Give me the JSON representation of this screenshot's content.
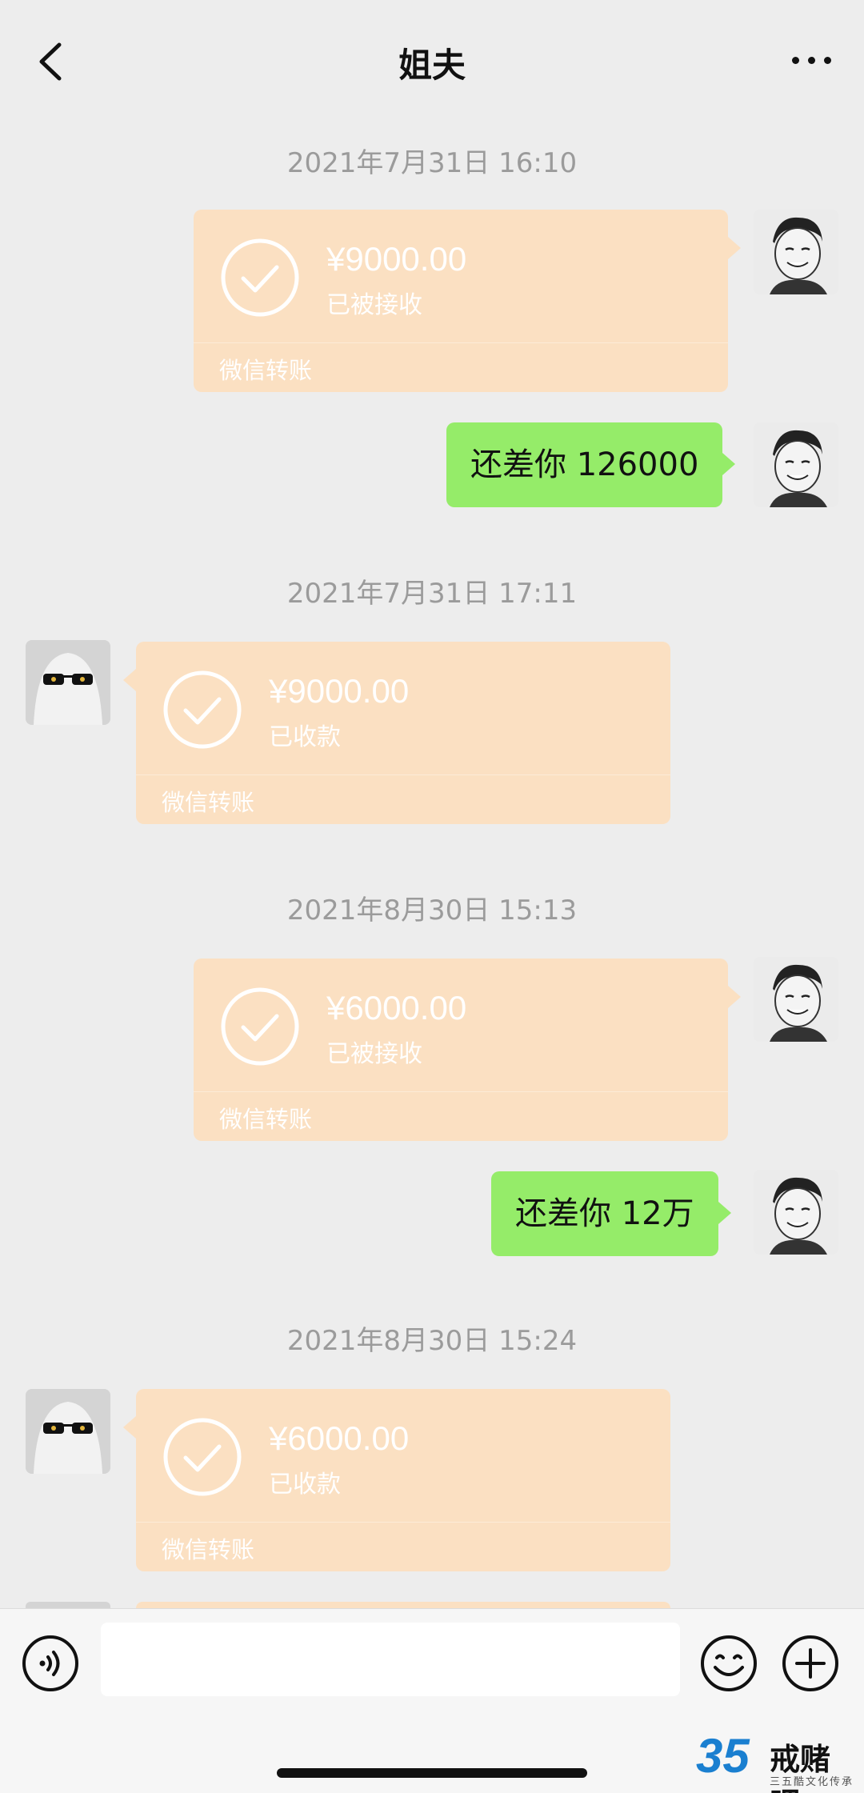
{
  "header": {
    "title": "姐夫",
    "back_icon": "chevron-left-icon",
    "more_icon": "ellipsis-icon"
  },
  "messages": [
    {
      "type": "timestamp",
      "text": "2021年7月31日 16:10"
    },
    {
      "type": "transfer",
      "from": "me",
      "amount": "¥9000.00",
      "status": "已被接收",
      "label": "微信转账"
    },
    {
      "type": "text",
      "from": "me",
      "text": "还差你 126000"
    },
    {
      "type": "timestamp",
      "text": "2021年7月31日 17:11"
    },
    {
      "type": "transfer",
      "from": "other",
      "amount": "¥9000.00",
      "status": "已收款",
      "label": "微信转账"
    },
    {
      "type": "timestamp",
      "text": "2021年8月30日 15:13"
    },
    {
      "type": "transfer",
      "from": "me",
      "amount": "¥6000.00",
      "status": "已被接收",
      "label": "微信转账"
    },
    {
      "type": "text",
      "from": "me",
      "text": "还差你 12万"
    },
    {
      "type": "timestamp",
      "text": "2021年8月30日 15:24"
    },
    {
      "type": "transfer",
      "from": "other",
      "amount": "¥6000.00",
      "status": "已收款",
      "label": "微信转账"
    }
  ],
  "input_bar": {
    "input_value": "",
    "voice_icon": "voice-icon",
    "emoji_icon": "emoji-icon",
    "plus_icon": "plus-icon"
  },
  "watermark": {
    "number": "35",
    "name": "戒赌吧",
    "subtitle": "三五酷文化传承"
  },
  "colors": {
    "background": "#ededed",
    "transfer_bubble": "#fbe0c2",
    "text_bubble": "#95ec69",
    "timestamp": "#9b9b9b"
  }
}
